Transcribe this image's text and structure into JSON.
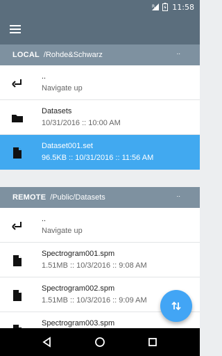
{
  "status_bar": {
    "time": "11:58"
  },
  "local": {
    "label": "LOCAL",
    "path": "/Rohde&Schwarz",
    "more": "..",
    "items": [
      {
        "title": "..",
        "subtitle": "Navigate up",
        "icon": "return-icon"
      },
      {
        "title": "Datasets",
        "subtitle": "10/31/2016 :: 10:00 AM",
        "icon": "folder-icon"
      },
      {
        "title": "Dataset001.set",
        "subtitle": "96.5KB :: 10/31/2016 :: 11:56 AM",
        "icon": "file-icon",
        "selected": true
      }
    ]
  },
  "remote": {
    "label": "REMOTE",
    "path": "/Public/Datasets",
    "more": "..",
    "items": [
      {
        "title": "..",
        "subtitle": "Navigate up",
        "icon": "return-icon"
      },
      {
        "title": "Spectrogram001.spm",
        "subtitle": "1.51MB :: 10/3/2016 :: 9:08 AM",
        "icon": "file-icon"
      },
      {
        "title": "Spectrogram002.spm",
        "subtitle": "1.51MB :: 10/3/2016 :: 9:09 AM",
        "icon": "file-icon"
      },
      {
        "title": "Spectrogram003.spm",
        "subtitle": "",
        "icon": "file-icon"
      }
    ]
  },
  "colors": {
    "app_bar": "#5b6e7d",
    "section_header": "#7e91a0",
    "selected": "#41a9f0",
    "fab": "#42a5f5"
  }
}
